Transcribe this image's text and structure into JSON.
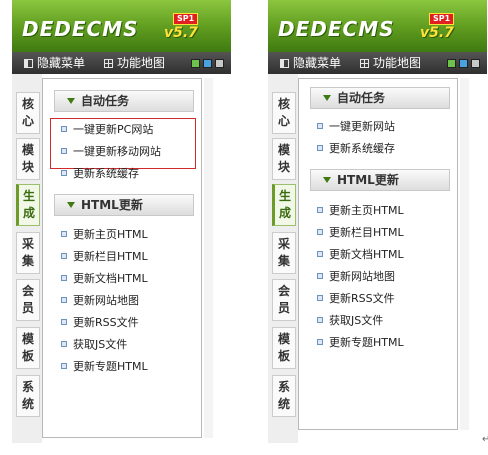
{
  "brand": {
    "logo": "DEDECMS",
    "version": "v5.7",
    "badge": "SP1"
  },
  "colors": {
    "accent_green": "#5e9b1e",
    "highlight_red": "#d12a2a",
    "swatches": [
      "#6cc24a",
      "#4aa3e0",
      "#c8c8c8"
    ]
  },
  "icons": {
    "hide_menu": "hide-panel-icon",
    "function_map": "grid-icon",
    "section": "chevron-down-icon",
    "item": "bullet-icon"
  },
  "panels": [
    {
      "toolbar": {
        "hide_menu": "隐藏菜单",
        "function_map": "功能地图"
      },
      "tabs": [
        {
          "label": "核心",
          "active": false
        },
        {
          "label": "模块",
          "active": false
        },
        {
          "label": "生成",
          "active": true
        },
        {
          "label": "采集",
          "active": false
        },
        {
          "label": "会员",
          "active": false
        },
        {
          "label": "模板",
          "active": false
        },
        {
          "label": "系统",
          "active": false
        }
      ],
      "sections": [
        {
          "title": "自动任务",
          "items": [
            "一键更新PC网站",
            "一键更新移动网站",
            "更新系统缓存"
          ]
        },
        {
          "title": "HTML更新",
          "items": [
            "更新主页HTML",
            "更新栏目HTML",
            "更新文档HTML",
            "更新网站地图",
            "更新RSS文件",
            "获取JS文件",
            "更新专题HTML"
          ]
        }
      ]
    },
    {
      "toolbar": {
        "hide_menu": "隐藏菜单",
        "function_map": "功能地图"
      },
      "tabs": [
        {
          "label": "核心",
          "active": false
        },
        {
          "label": "模块",
          "active": false
        },
        {
          "label": "生成",
          "active": true
        },
        {
          "label": "采集",
          "active": false
        },
        {
          "label": "会员",
          "active": false
        },
        {
          "label": "模板",
          "active": false
        },
        {
          "label": "系统",
          "active": false
        }
      ],
      "sections": [
        {
          "title": "自动任务",
          "items": [
            "一键更新网站",
            "更新系统缓存"
          ]
        },
        {
          "title": "HTML更新",
          "items": [
            "更新主页HTML",
            "更新栏目HTML",
            "更新文档HTML",
            "更新网站地图",
            "更新RSS文件",
            "获取JS文件",
            "更新专题HTML"
          ]
        }
      ]
    }
  ],
  "corner_mark": "↵"
}
